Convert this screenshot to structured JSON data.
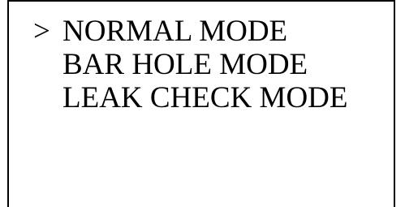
{
  "screen": {
    "cursor_glyph": ">",
    "selected_index": 0,
    "menu": [
      {
        "label": "NORMAL MODE"
      },
      {
        "label": "BAR HOLE MODE"
      },
      {
        "label": "LEAK CHECK MODE"
      }
    ]
  }
}
